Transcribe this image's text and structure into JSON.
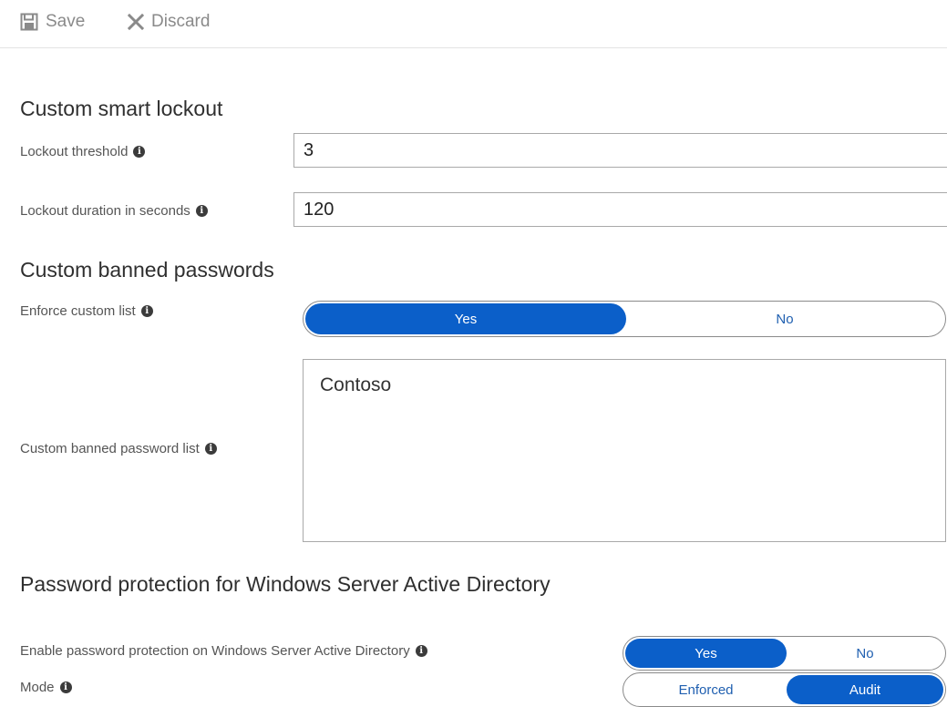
{
  "toolbar": {
    "save_label": "Save",
    "discard_label": "Discard"
  },
  "sections": {
    "lockout_title": "Custom smart lockout",
    "banned_title": "Custom banned passwords",
    "ad_title": "Password protection for Windows Server Active Directory"
  },
  "lockout": {
    "threshold_label": "Lockout threshold",
    "threshold_value": "3",
    "duration_label": "Lockout duration in seconds",
    "duration_value": "120"
  },
  "banned": {
    "enforce_label": "Enforce custom list",
    "enforce_yes": "Yes",
    "enforce_no": "No",
    "enforce_selected": "Yes",
    "list_label": "Custom banned password list",
    "list_value": "Contoso"
  },
  "ad": {
    "enable_label": "Enable password protection on Windows Server Active Directory",
    "enable_yes": "Yes",
    "enable_no": "No",
    "enable_selected": "Yes",
    "mode_label": "Mode",
    "mode_enforced": "Enforced",
    "mode_audit": "Audit",
    "mode_selected": "Audit"
  },
  "colors": {
    "accent": "#0b5fc9",
    "toolbar_text": "#8a8a8a"
  },
  "icons": {
    "save": "save-icon",
    "discard": "close-icon",
    "info": "info-icon"
  }
}
